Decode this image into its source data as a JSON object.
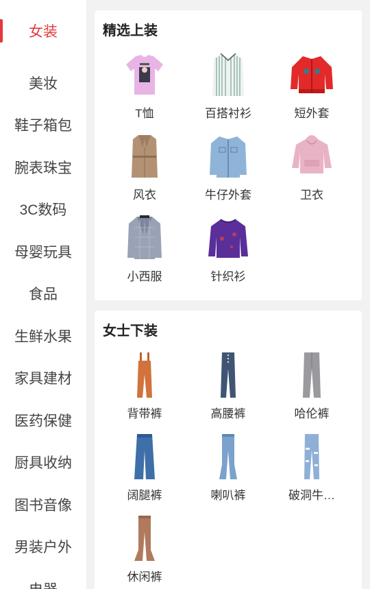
{
  "sidebar": {
    "items": [
      {
        "label": "女装"
      },
      {
        "label": "美妆"
      },
      {
        "label": "鞋子箱包"
      },
      {
        "label": "腕表珠宝"
      },
      {
        "label": "3C数码"
      },
      {
        "label": "母婴玩具"
      },
      {
        "label": "食品"
      },
      {
        "label": "生鲜水果"
      },
      {
        "label": "家具建材"
      },
      {
        "label": "医药保健"
      },
      {
        "label": "厨具收纳"
      },
      {
        "label": "图书音像"
      },
      {
        "label": "男装户外"
      },
      {
        "label": "电器"
      }
    ],
    "active_color": "#e4393c"
  },
  "sections": [
    {
      "title": "精选上装",
      "items": [
        {
          "label": "T恤",
          "icon": "tshirt-icon"
        },
        {
          "label": "百搭衬衫",
          "icon": "shirt-icon"
        },
        {
          "label": "短外套",
          "icon": "short-jacket-icon"
        },
        {
          "label": "风衣",
          "icon": "trench-coat-icon"
        },
        {
          "label": "牛仔外套",
          "icon": "denim-jacket-icon"
        },
        {
          "label": "卫衣",
          "icon": "hoodie-icon"
        },
        {
          "label": "小西服",
          "icon": "blazer-icon"
        },
        {
          "label": "针织衫",
          "icon": "knit-sweater-icon"
        }
      ]
    },
    {
      "title": "女士下装",
      "items": [
        {
          "label": "背带裤",
          "icon": "overalls-icon"
        },
        {
          "label": "高腰裤",
          "icon": "high-waist-jeans-icon"
        },
        {
          "label": "哈伦裤",
          "icon": "harem-pants-icon"
        },
        {
          "label": "阔腿裤",
          "icon": "wide-leg-pants-icon"
        },
        {
          "label": "喇叭裤",
          "icon": "flare-jeans-icon"
        },
        {
          "label": "破洞牛…",
          "icon": "ripped-jeans-icon"
        },
        {
          "label": "休闲裤",
          "icon": "casual-pants-icon"
        }
      ]
    }
  ]
}
